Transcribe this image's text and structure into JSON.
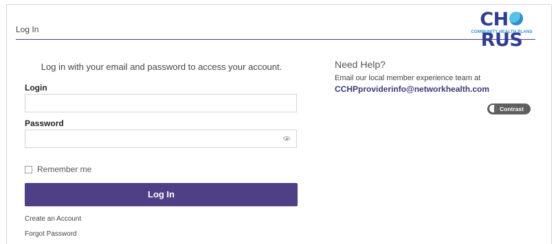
{
  "header": {
    "title": "Log In"
  },
  "logo": {
    "word_left": "CH",
    "word_right": "RUS",
    "subtitle": "COMMUNITY HEALTH PLANS"
  },
  "form": {
    "intro": "Log in with your email and password to access your account.",
    "login_label": "Login",
    "login_value": "",
    "password_label": "Password",
    "password_value": "",
    "remember_label": "Remember me",
    "remember_checked": false,
    "submit_label": "Log In",
    "create_account": "Create an Account",
    "forgot_password": "Forgot Password"
  },
  "help": {
    "title": "Need Help?",
    "text": "Email our local member experience team at",
    "email": "CCHPproviderinfo@networkhealth.com"
  },
  "contrast": {
    "label": "Contrast"
  },
  "colors": {
    "accent": "#4f3f86",
    "logo_blue": "#2f3e93",
    "logo_light": "#2f8ecf"
  }
}
